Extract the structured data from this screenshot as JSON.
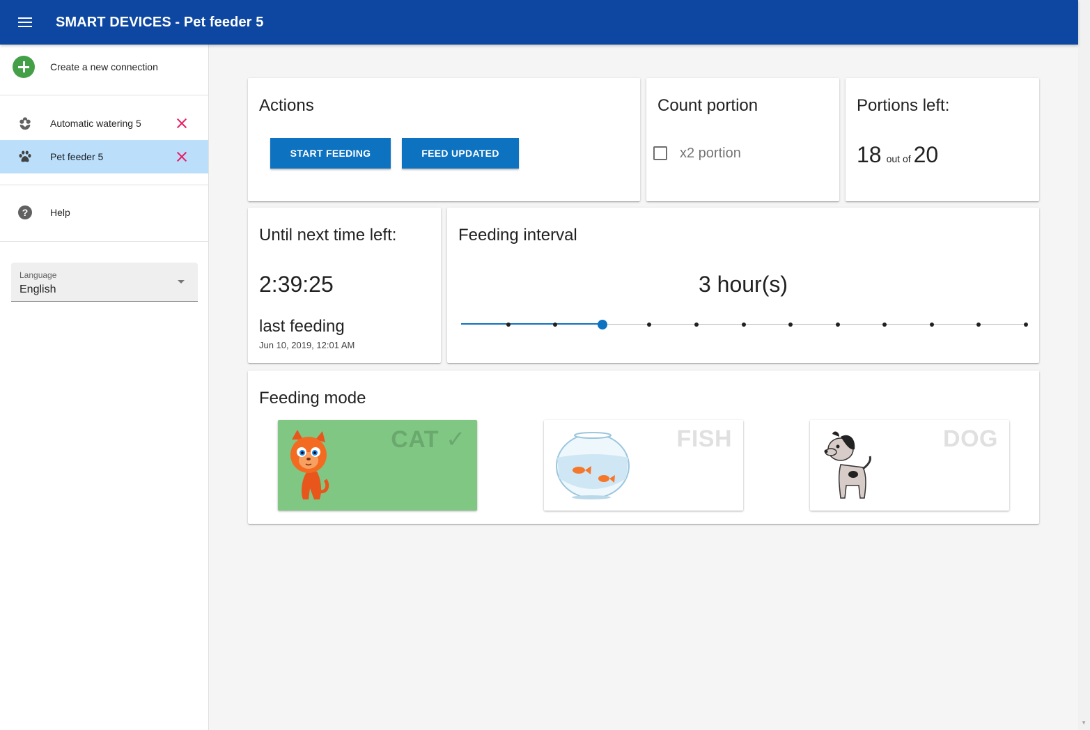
{
  "app": {
    "title": "SMART DEVICES - Pet feeder 5"
  },
  "drawer": {
    "create_label": "Create a new connection",
    "connections": [
      {
        "label": "Automatic watering 5",
        "icon": "flower-icon",
        "active": false
      },
      {
        "label": "Pet feeder 5",
        "icon": "paw-icon",
        "active": true
      }
    ],
    "help_label": "Help",
    "language": {
      "label": "Language",
      "value": "English"
    }
  },
  "actions": {
    "title": "Actions",
    "start_feeding": "START FEEDING",
    "feed_updated": "FEED UPDATED"
  },
  "count_portion": {
    "title": "Count portion",
    "checkbox_label": "x2 portion",
    "checked": false
  },
  "portions_left": {
    "title": "Portions left:",
    "current": "18",
    "separator": "out of",
    "total": "20"
  },
  "timer": {
    "title": "Until next time left:",
    "value": "2:39:25",
    "last_feeding_label": "last feeding",
    "last_feeding_date": "Jun 10, 2019, 12:01 AM"
  },
  "interval": {
    "title": "Feeding interval",
    "value_text": "3 hour(s)",
    "value": 3,
    "min": 0,
    "max": 12,
    "accent": "#0d72c0"
  },
  "feeding_mode": {
    "title": "Feeding mode",
    "modes": [
      {
        "label": "CAT ✓",
        "selected": true
      },
      {
        "label": "FISH",
        "selected": false
      },
      {
        "label": "DOG",
        "selected": false
      }
    ]
  },
  "colors": {
    "appbar": "#0d47a1",
    "button": "#0d72c0",
    "selected_mode": "#81c784",
    "active_item": "#bbdefb",
    "remove_icon": "#e91e63"
  }
}
